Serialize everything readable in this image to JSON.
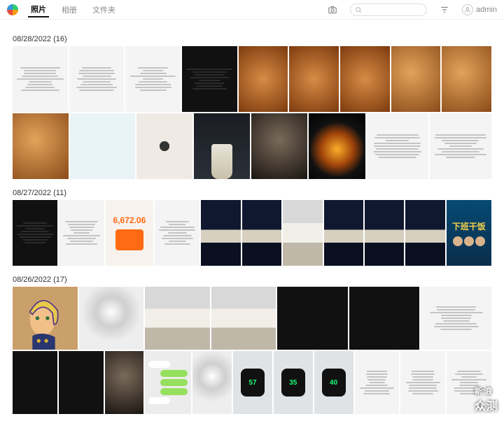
{
  "nav": {
    "photos": "照片",
    "albums": "相册",
    "folders": "文件夹"
  },
  "user": {
    "name": "admin"
  },
  "groups": [
    {
      "date": "08/28/2022",
      "count": 16
    },
    {
      "date": "08/27/2022",
      "count": 11
    },
    {
      "date": "08/26/2022",
      "count": 17
    }
  ],
  "g0": {
    "row0": [
      {
        "kind": "ui-light",
        "name": "screenshot-settings-1"
      },
      {
        "kind": "ui-light",
        "name": "screenshot-settings-2"
      },
      {
        "kind": "ui-light",
        "name": "screenshot-settings-3"
      },
      {
        "kind": "ui-dark",
        "name": "screenshot-dark-car"
      },
      {
        "kind": "ribs",
        "name": "food-ribs-grill-1"
      },
      {
        "kind": "ribs",
        "name": "food-ribs-grill-2"
      },
      {
        "kind": "ribs",
        "name": "food-ribs-grill-3"
      },
      {
        "kind": "food",
        "name": "food-meat-chopsticks-1"
      },
      {
        "kind": "food",
        "name": "food-meat-chopsticks-2"
      }
    ],
    "row1": [
      {
        "kind": "food",
        "name": "food-stirfry"
      },
      {
        "kind": "phonegrid",
        "name": "screenshot-homescreen"
      },
      {
        "kind": "dangling",
        "name": "photo-seed-hanging"
      },
      {
        "kind": "cup",
        "name": "photo-frothy-cup"
      },
      {
        "kind": "person",
        "name": "video-call-portrait"
      },
      {
        "kind": "stove",
        "name": "food-wok-stove"
      },
      {
        "kind": "ui-light",
        "name": "screenshot-app-1"
      },
      {
        "kind": "ui-light",
        "name": "screenshot-app-2"
      }
    ]
  },
  "g1": {
    "row0": [
      {
        "kind": "ui-dark",
        "name": "screenshot-video-feed"
      },
      {
        "kind": "ui-light",
        "name": "screenshot-news-feed"
      },
      {
        "kind": "orange",
        "name": "screenshot-balance",
        "value": "6,672.06"
      },
      {
        "kind": "ui-light",
        "name": "screenshot-activity-rings"
      },
      {
        "kind": "desk-blue",
        "name": "desk-setup-night-1"
      },
      {
        "kind": "desk-blue",
        "name": "desk-setup-night-2"
      },
      {
        "kind": "desk-white",
        "name": "desk-setup-day-1"
      },
      {
        "kind": "desk-blue",
        "name": "desk-setup-night-3"
      },
      {
        "kind": "desk-blue",
        "name": "desk-setup-night-4"
      },
      {
        "kind": "desk-blue",
        "name": "desk-setup-night-5"
      },
      {
        "kind": "ad",
        "name": "ad-banner",
        "title": "下班干饭"
      }
    ]
  },
  "g2": {
    "row0": [
      {
        "kind": "anime",
        "name": "anime-character-giorno"
      },
      {
        "kind": "studio",
        "name": "photo-softbox-1"
      },
      {
        "kind": "desk-white",
        "name": "studio-desk-1"
      },
      {
        "kind": "desk-white",
        "name": "studio-desk-2"
      },
      {
        "kind": "chartdark",
        "name": "screenshot-stats-1"
      },
      {
        "kind": "chartdark",
        "name": "screenshot-stats-2"
      },
      {
        "kind": "ui-light",
        "name": "screenshot-list"
      }
    ],
    "row1": [
      {
        "kind": "chartdark",
        "name": "screenshot-stats-3"
      },
      {
        "kind": "chartdark",
        "name": "screenshot-stats-4"
      },
      {
        "kind": "person",
        "name": "screenshot-portrait"
      },
      {
        "kind": "chat",
        "name": "screenshot-chat"
      },
      {
        "kind": "studio",
        "name": "photo-softbox-2"
      },
      {
        "kind": "watch",
        "name": "watch-face-1",
        "value": "57"
      },
      {
        "kind": "watch",
        "name": "watch-face-2",
        "value": "35"
      },
      {
        "kind": "watch",
        "name": "watch-face-3",
        "value": "40"
      },
      {
        "kind": "ui-light",
        "name": "screenshot-form"
      },
      {
        "kind": "ui-light",
        "name": "screenshot-calendar-grid"
      },
      {
        "kind": "ui-light",
        "name": "screenshot-text-page"
      }
    ]
  },
  "watermark": {
    "line1": "新浪",
    "line2": "众测"
  }
}
